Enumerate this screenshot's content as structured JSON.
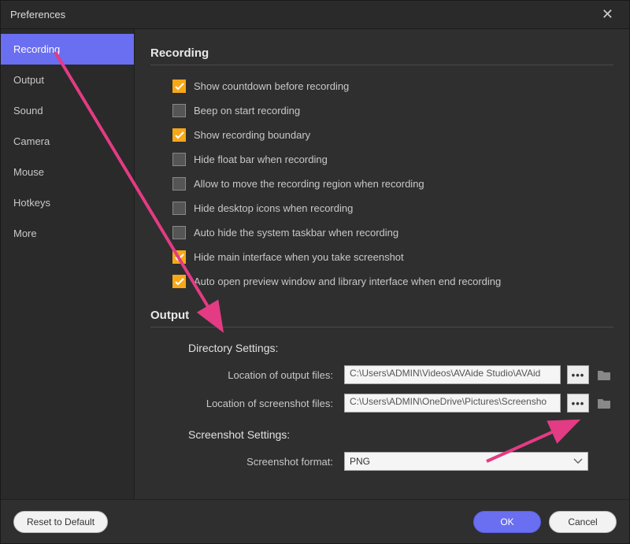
{
  "window": {
    "title": "Preferences"
  },
  "sidebar": {
    "items": [
      {
        "label": "Recording",
        "active": true
      },
      {
        "label": "Output"
      },
      {
        "label": "Sound"
      },
      {
        "label": "Camera"
      },
      {
        "label": "Mouse"
      },
      {
        "label": "Hotkeys"
      },
      {
        "label": "More"
      }
    ]
  },
  "sections": {
    "recording": {
      "title": "Recording",
      "options": [
        {
          "label": "Show countdown before recording",
          "checked": true
        },
        {
          "label": "Beep on start recording",
          "checked": false
        },
        {
          "label": "Show recording boundary",
          "checked": true
        },
        {
          "label": "Hide float bar when recording",
          "checked": false
        },
        {
          "label": "Allow to move the recording region when recording",
          "checked": false
        },
        {
          "label": "Hide desktop icons when recording",
          "checked": false
        },
        {
          "label": "Auto hide the system taskbar when recording",
          "checked": false
        },
        {
          "label": "Hide main interface when you take screenshot",
          "checked": true
        },
        {
          "label": "Auto open preview window and library interface when end recording",
          "checked": true
        }
      ]
    },
    "output": {
      "title": "Output",
      "directory_heading": "Directory Settings:",
      "output_files_label": "Location of output files:",
      "output_files_value": "C:\\Users\\ADMIN\\Videos\\AVAide Studio\\AVAid",
      "screenshot_files_label": "Location of screenshot files:",
      "screenshot_files_value": "C:\\Users\\ADMIN\\OneDrive\\Pictures\\Screensho",
      "screenshot_heading": "Screenshot Settings:",
      "screenshot_format_label": "Screenshot format:",
      "screenshot_format_value": "PNG"
    }
  },
  "footer": {
    "reset_label": "Reset to Default",
    "ok_label": "OK",
    "cancel_label": "Cancel"
  },
  "browse_dots": "•••"
}
